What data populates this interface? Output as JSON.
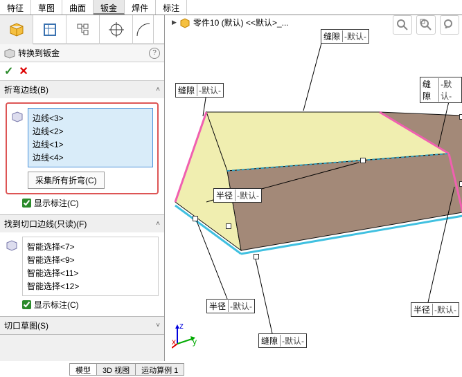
{
  "topTabs": {
    "t0": "特征",
    "t1": "草图",
    "t2": "曲面",
    "t3": "钣金",
    "t4": "焊件",
    "t5": "标注"
  },
  "panel": {
    "title": "转换到钣金",
    "bendSection": "折弯边线(B)",
    "bendItems": {
      "i0": "边线<3>",
      "i1": "边线<2>",
      "i2": "边线<1>",
      "i3": "边线<4>"
    },
    "collectBtn": "采集所有折弯(C)",
    "showLabel": "显示标注(C)",
    "cutSection": "找到切口边线(只读)(F)",
    "cutItems": {
      "i0": "智能选择<7>",
      "i1": "智能选择<9>",
      "i2": "智能选择<11>",
      "i3": "智能选择<12>"
    },
    "sketchSection": "切口草图(S)"
  },
  "viewport": {
    "partName": "零件10 (默认) <<默认>_...",
    "gapLabel": "缝隙",
    "defLabel": "-默认-",
    "radiusLabel": "半径"
  },
  "bottomTabs": {
    "t0": "模型",
    "t1": "3D 视图",
    "t2": "运动算例 1"
  }
}
